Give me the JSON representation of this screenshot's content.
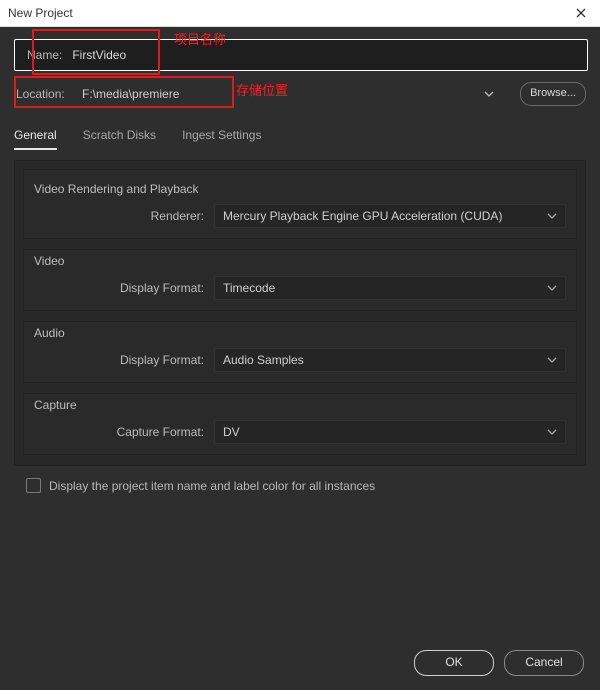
{
  "window": {
    "title": "New Project"
  },
  "annotations": {
    "name_label_cn": "项目名称",
    "location_label_cn": "存储位置"
  },
  "name": {
    "label": "Name:",
    "value": "FirstVideo"
  },
  "location": {
    "label": "Location:",
    "path": "F:\\media\\premiere",
    "browse": "Browse..."
  },
  "tabs": {
    "general": "General",
    "scratch": "Scratch Disks",
    "ingest": "Ingest Settings"
  },
  "sections": {
    "render": {
      "title": "Video Rendering and Playback",
      "renderer_label": "Renderer:",
      "renderer_value": "Mercury Playback Engine GPU Acceleration (CUDA)"
    },
    "video": {
      "title": "Video",
      "format_label": "Display Format:",
      "format_value": "Timecode"
    },
    "audio": {
      "title": "Audio",
      "format_label": "Display Format:",
      "format_value": "Audio Samples"
    },
    "capture": {
      "title": "Capture",
      "format_label": "Capture Format:",
      "format_value": "DV"
    }
  },
  "checkbox": {
    "label": "Display the project item name and label color for all instances"
  },
  "buttons": {
    "ok": "OK",
    "cancel": "Cancel"
  }
}
